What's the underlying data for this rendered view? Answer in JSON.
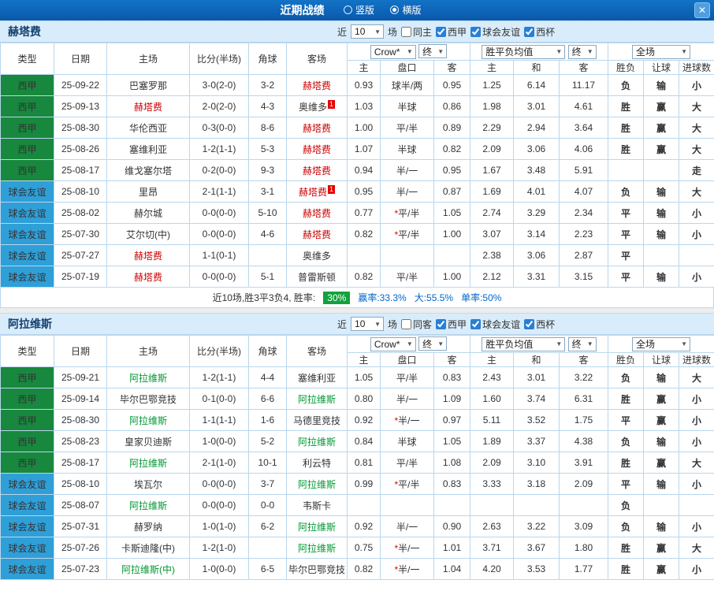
{
  "header": {
    "title": "近期战绩",
    "radio_vertical": "竖版",
    "radio_horizontal": "横版",
    "vertical_checked": false,
    "horizontal_checked": true,
    "close_icon": "✕",
    "bar_color": "#0b62b4"
  },
  "filters_labels": {
    "near": "近",
    "matches": "场"
  },
  "columns": {
    "type": "类型",
    "date": "日期",
    "home": "主场",
    "score": "比分(半场)",
    "corners": "角球",
    "away": "客场",
    "crown": "Crow*",
    "final": "终",
    "avg": "胜平负均值",
    "full": "全场",
    "odds_home": "主",
    "odds_line": "盘口",
    "odds_away": "客",
    "avg_home": "主",
    "avg_draw": "和",
    "avg_away": "客",
    "res_wdl": "胜负",
    "res_handicap": "让球",
    "res_goals": "进球数"
  },
  "colors": {
    "league_bg": "#17883e",
    "friendly_bg": "#2f9fd8",
    "win": "#d40000",
    "draw": "#0000cc",
    "lose": "#009933",
    "push": "#ee7700",
    "focal_home_team": "#cc0000",
    "focal_away_team": "#009933"
  },
  "sections": [
    {
      "team": "赫塔费",
      "focal_color": "#cc0000",
      "filters": {
        "count": "10",
        "same": "同主",
        "same_checked": false,
        "league": "西甲",
        "league_checked": true,
        "friendly": "球会友谊",
        "friendly_checked": true,
        "cup": "西杯",
        "cup_checked": true
      },
      "rows": [
        {
          "t": "西甲",
          "ts": "league",
          "d": "25-09-22",
          "h": {
            "n": "巴塞罗那"
          },
          "s": "3-0(2-0)",
          "c": "3-2",
          "a": {
            "n": "赫塔费",
            "f": true
          },
          "o": [
            "0.93",
            "球半/两",
            "0.95"
          ],
          "v": [
            "1.25",
            "6.14",
            "11.17"
          ],
          "r": [
            [
              "负",
              "lose"
            ],
            [
              "输",
              "lose"
            ],
            [
              "小",
              "lose"
            ]
          ]
        },
        {
          "t": "西甲",
          "ts": "league",
          "d": "25-09-13",
          "h": {
            "n": "赫塔费",
            "f": true
          },
          "s": "2-0(2-0)",
          "c": "4-3",
          "a": {
            "n": "奥维多",
            "b": "1"
          },
          "o": [
            "1.03",
            "半球",
            "0.86"
          ],
          "v": [
            "1.98",
            "3.01",
            "4.61"
          ],
          "r": [
            [
              "胜",
              "win"
            ],
            [
              "赢",
              "win"
            ],
            [
              "大",
              "win"
            ]
          ]
        },
        {
          "t": "西甲",
          "ts": "league",
          "d": "25-08-30",
          "h": {
            "n": "华伦西亚"
          },
          "s": "0-3(0-0)",
          "c": "8-6",
          "a": {
            "n": "赫塔费",
            "f": true
          },
          "o": [
            "1.00",
            "平/半",
            "0.89"
          ],
          "v": [
            "2.29",
            "2.94",
            "3.64"
          ],
          "r": [
            [
              "胜",
              "win"
            ],
            [
              "赢",
              "win"
            ],
            [
              "大",
              "win"
            ]
          ]
        },
        {
          "t": "西甲",
          "ts": "league",
          "d": "25-08-26",
          "h": {
            "n": "塞维利亚"
          },
          "s": "1-2(1-1)",
          "c": "5-3",
          "a": {
            "n": "赫塔费",
            "f": true
          },
          "o": [
            "1.07",
            "半球",
            "0.82"
          ],
          "v": [
            "2.09",
            "3.06",
            "4.06"
          ],
          "r": [
            [
              "胜",
              "win"
            ],
            [
              "赢",
              "win"
            ],
            [
              "大",
              "win"
            ]
          ]
        },
        {
          "t": "西甲",
          "ts": "league",
          "d": "25-08-17",
          "h": {
            "n": "维戈塞尔塔"
          },
          "s": "0-2(0-0)",
          "c": "9-3",
          "a": {
            "n": "赫塔费",
            "f": true
          },
          "o": [
            "0.94",
            "半/一",
            "0.95"
          ],
          "v": [
            "1.67",
            "3.48",
            "5.91"
          ],
          "r": [
            [
              "",
              ""
            ],
            [
              "",
              ""
            ],
            [
              "走",
              "push"
            ]
          ]
        },
        {
          "t": "球会友谊",
          "ts": "friendly",
          "d": "25-08-10",
          "h": {
            "n": "里昂"
          },
          "s": "2-1(1-1)",
          "c": "3-1",
          "a": {
            "n": "赫塔费",
            "f": true,
            "b": "1"
          },
          "o": [
            "0.95",
            "半/一",
            "0.87"
          ],
          "v": [
            "1.69",
            "4.01",
            "4.07"
          ],
          "r": [
            [
              "负",
              "lose"
            ],
            [
              "输",
              "lose"
            ],
            [
              "大",
              "win"
            ]
          ]
        },
        {
          "t": "球会友谊",
          "ts": "friendly",
          "d": "25-08-02",
          "h": {
            "n": "赫尔城"
          },
          "s": "0-0(0-0)",
          "c": "5-10",
          "a": {
            "n": "赫塔费",
            "f": true
          },
          "o": [
            "0.77",
            "*平/半",
            "1.05"
          ],
          "v": [
            "2.74",
            "3.29",
            "2.34"
          ],
          "r": [
            [
              "平",
              "draw"
            ],
            [
              "输",
              "lose"
            ],
            [
              "小",
              "lose"
            ]
          ]
        },
        {
          "t": "球会友谊",
          "ts": "friendly",
          "d": "25-07-30",
          "h": {
            "n": "艾尔切(中)"
          },
          "s": "0-0(0-0)",
          "c": "4-6",
          "a": {
            "n": "赫塔费",
            "f": true
          },
          "o": [
            "0.82",
            "*平/半",
            "1.00"
          ],
          "v": [
            "3.07",
            "3.14",
            "2.23"
          ],
          "r": [
            [
              "平",
              "draw"
            ],
            [
              "输",
              "lose"
            ],
            [
              "小",
              "lose"
            ]
          ]
        },
        {
          "t": "球会友谊",
          "ts": "friendly",
          "d": "25-07-27",
          "h": {
            "n": "赫塔费",
            "f": true
          },
          "s": "1-1(0-1)",
          "c": "",
          "a": {
            "n": "奥维多"
          },
          "o": [
            "",
            "",
            ""
          ],
          "v": [
            "2.38",
            "3.06",
            "2.87"
          ],
          "r": [
            [
              "平",
              "draw"
            ],
            [
              "",
              ""
            ],
            [
              "",
              ""
            ]
          ]
        },
        {
          "t": "球会友谊",
          "ts": "friendly",
          "d": "25-07-19",
          "h": {
            "n": "赫塔费",
            "f": true
          },
          "s": "0-0(0-0)",
          "c": "5-1",
          "a": {
            "n": "普雷斯顿"
          },
          "o": [
            "0.82",
            "平/半",
            "1.00"
          ],
          "v": [
            "2.12",
            "3.31",
            "3.15"
          ],
          "r": [
            [
              "平",
              "draw"
            ],
            [
              "输",
              "lose"
            ],
            [
              "小",
              "lose"
            ]
          ]
        }
      ],
      "summary": [
        {
          "text": "近10场,胜3平3负4, 胜率:",
          "style": "plain"
        },
        {
          "text": "30%",
          "style": "badge"
        },
        {
          "text": "赢率:33.3%",
          "style": "blue"
        },
        {
          "text": "大:55.5%",
          "style": "blue"
        },
        {
          "text": "单率:50%",
          "style": "blue"
        }
      ]
    },
    {
      "team": "阿拉维斯",
      "focal_color": "#009933",
      "filters": {
        "count": "10",
        "same": "同客",
        "same_checked": false,
        "league": "西甲",
        "league_checked": true,
        "friendly": "球会友谊",
        "friendly_checked": true,
        "cup": "西杯",
        "cup_checked": true
      },
      "rows": [
        {
          "t": "西甲",
          "ts": "league",
          "d": "25-09-21",
          "h": {
            "n": "阿拉维斯",
            "f": true
          },
          "s": "1-2(1-1)",
          "c": "4-4",
          "a": {
            "n": "塞维利亚"
          },
          "o": [
            "1.05",
            "平/半",
            "0.83"
          ],
          "v": [
            "2.43",
            "3.01",
            "3.22"
          ],
          "r": [
            [
              "负",
              "lose"
            ],
            [
              "输",
              "lose"
            ],
            [
              "大",
              "win"
            ]
          ]
        },
        {
          "t": "西甲",
          "ts": "league",
          "d": "25-09-14",
          "h": {
            "n": "毕尔巴鄂竞技"
          },
          "s": "0-1(0-0)",
          "c": "6-6",
          "a": {
            "n": "阿拉维斯",
            "f": true
          },
          "o": [
            "0.80",
            "半/一",
            "1.09"
          ],
          "v": [
            "1.60",
            "3.74",
            "6.31"
          ],
          "r": [
            [
              "胜",
              "win"
            ],
            [
              "赢",
              "win"
            ],
            [
              "小",
              "lose"
            ]
          ]
        },
        {
          "t": "西甲",
          "ts": "league",
          "d": "25-08-30",
          "h": {
            "n": "阿拉维斯",
            "f": true
          },
          "s": "1-1(1-1)",
          "c": "1-6",
          "a": {
            "n": "马德里竞技"
          },
          "o": [
            "0.92",
            "*半/一",
            "0.97"
          ],
          "v": [
            "5.11",
            "3.52",
            "1.75"
          ],
          "r": [
            [
              "平",
              "draw"
            ],
            [
              "赢",
              "win"
            ],
            [
              "小",
              "lose"
            ]
          ]
        },
        {
          "t": "西甲",
          "ts": "league",
          "d": "25-08-23",
          "h": {
            "n": "皇家贝迪斯"
          },
          "s": "1-0(0-0)",
          "c": "5-2",
          "a": {
            "n": "阿拉维斯",
            "f": true
          },
          "o": [
            "0.84",
            "半球",
            "1.05"
          ],
          "v": [
            "1.89",
            "3.37",
            "4.38"
          ],
          "r": [
            [
              "负",
              "lose"
            ],
            [
              "输",
              "lose"
            ],
            [
              "小",
              "lose"
            ]
          ]
        },
        {
          "t": "西甲",
          "ts": "league",
          "d": "25-08-17",
          "h": {
            "n": "阿拉维斯",
            "f": true
          },
          "s": "2-1(1-0)",
          "c": "10-1",
          "a": {
            "n": "利云特"
          },
          "o": [
            "0.81",
            "平/半",
            "1.08"
          ],
          "v": [
            "2.09",
            "3.10",
            "3.91"
          ],
          "r": [
            [
              "胜",
              "win"
            ],
            [
              "赢",
              "win"
            ],
            [
              "大",
              "win"
            ]
          ]
        },
        {
          "t": "球会友谊",
          "ts": "friendly",
          "d": "25-08-10",
          "h": {
            "n": "埃瓦尔"
          },
          "s": "0-0(0-0)",
          "c": "3-7",
          "a": {
            "n": "阿拉维斯",
            "f": true
          },
          "o": [
            "0.99",
            "*平/半",
            "0.83"
          ],
          "v": [
            "3.33",
            "3.18",
            "2.09"
          ],
          "r": [
            [
              "平",
              "draw"
            ],
            [
              "输",
              "lose"
            ],
            [
              "小",
              "lose"
            ]
          ]
        },
        {
          "t": "球会友谊",
          "ts": "friendly",
          "d": "25-08-07",
          "h": {
            "n": "阿拉维斯",
            "f": true
          },
          "s": "0-0(0-0)",
          "c": "0-0",
          "a": {
            "n": "韦斯卡"
          },
          "o": [
            "",
            "",
            ""
          ],
          "v": [
            "",
            "",
            ""
          ],
          "r": [
            [
              "负",
              "lose"
            ],
            [
              "",
              ""
            ],
            [
              "",
              ""
            ]
          ]
        },
        {
          "t": "球会友谊",
          "ts": "friendly",
          "d": "25-07-31",
          "h": {
            "n": "赫罗纳"
          },
          "s": "1-0(1-0)",
          "c": "6-2",
          "a": {
            "n": "阿拉维斯",
            "f": true
          },
          "o": [
            "0.92",
            "半/一",
            "0.90"
          ],
          "v": [
            "2.63",
            "3.22",
            "3.09"
          ],
          "r": [
            [
              "负",
              "lose"
            ],
            [
              "输",
              "lose"
            ],
            [
              "小",
              "lose"
            ]
          ]
        },
        {
          "t": "球会友谊",
          "ts": "friendly",
          "d": "25-07-26",
          "h": {
            "n": "卡斯迪隆(中)"
          },
          "s": "1-2(1-0)",
          "c": "",
          "a": {
            "n": "阿拉维斯",
            "f": true
          },
          "o": [
            "0.75",
            "*半/一",
            "1.01"
          ],
          "v": [
            "3.71",
            "3.67",
            "1.80"
          ],
          "r": [
            [
              "胜",
              "win"
            ],
            [
              "赢",
              "win"
            ],
            [
              "大",
              "win"
            ]
          ]
        },
        {
          "t": "球会友谊",
          "ts": "friendly",
          "d": "25-07-23",
          "h": {
            "n": "阿拉维斯(中)",
            "f": true
          },
          "s": "1-0(0-0)",
          "c": "6-5",
          "a": {
            "n": "毕尔巴鄂竞技"
          },
          "o": [
            "0.82",
            "*半/一",
            "1.04"
          ],
          "v": [
            "4.20",
            "3.53",
            "1.77"
          ],
          "r": [
            [
              "胜",
              "win"
            ],
            [
              "赢",
              "win"
            ],
            [
              "小",
              "lose"
            ]
          ]
        }
      ],
      "summary": []
    }
  ]
}
